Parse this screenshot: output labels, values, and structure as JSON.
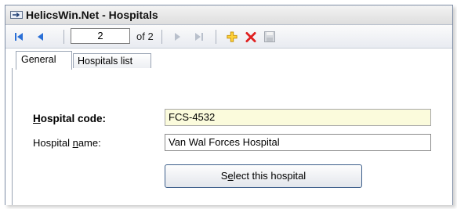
{
  "window": {
    "title": "HelicsWin.Net - Hospitals"
  },
  "navigator": {
    "position": "2",
    "of_label": "of 2"
  },
  "tabs": [
    {
      "label": "General"
    },
    {
      "label": "Hospitals list"
    }
  ],
  "form": {
    "code_label_pre": "",
    "code_label_accel": "H",
    "code_label_post": "ospital code:",
    "code_value": "FCS-4532",
    "name_label_pre": "Hospital ",
    "name_label_accel": "n",
    "name_label_post": "ame:",
    "name_value": "Van Wal Forces Hospital",
    "select_pre": "S",
    "select_accel": "e",
    "select_post": "lect this hospital"
  },
  "colors": {
    "code_field_bg": "#fbfbdc",
    "nav_icon": "#2a6fd6",
    "delete_icon": "#e02020",
    "add_icon": "#f0a800"
  }
}
